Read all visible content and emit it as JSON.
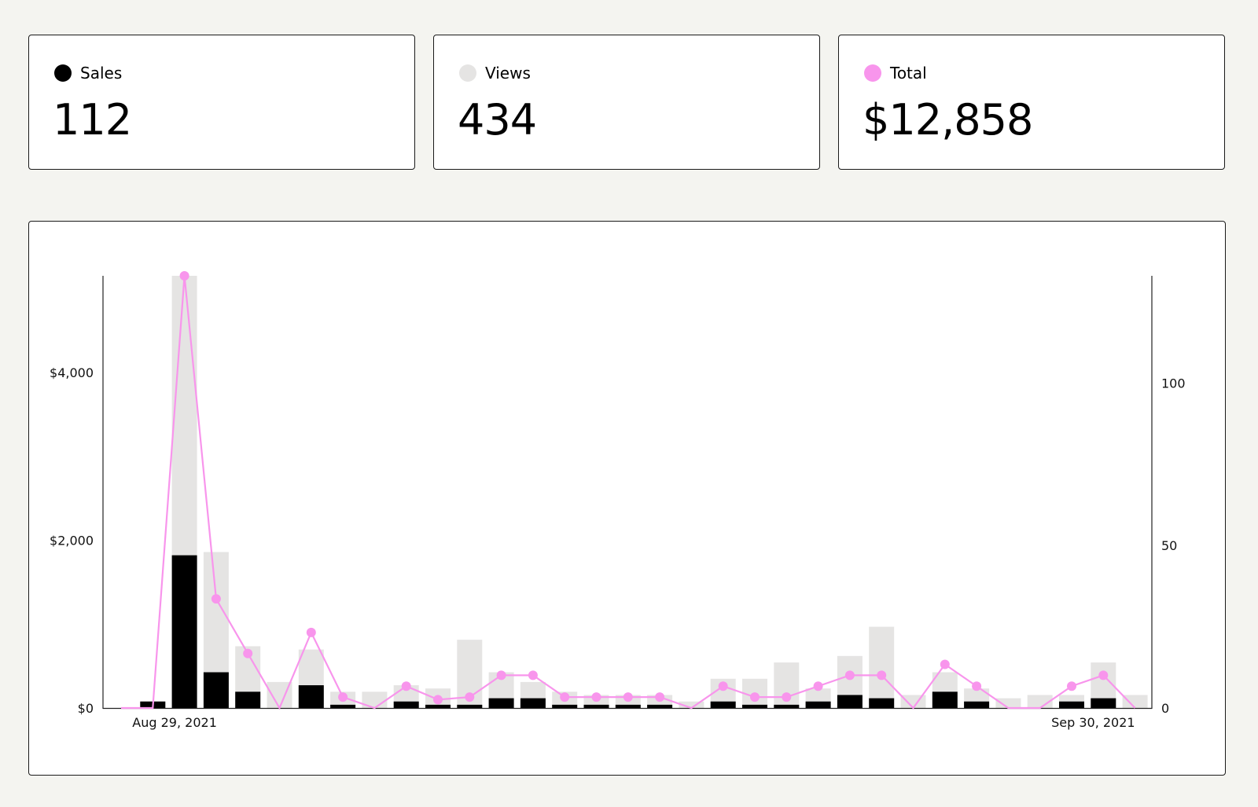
{
  "stats": {
    "sales": {
      "label": "Sales",
      "value": "112",
      "color": "#000000"
    },
    "views": {
      "label": "Views",
      "value": "434",
      "color": "#e5e4e3"
    },
    "total": {
      "label": "Total",
      "value": "$12,858",
      "color": "#f895ec"
    }
  },
  "chart_data": {
    "type": "bar",
    "grid": false,
    "x_start_label": "Aug 29, 2021",
    "x_end_label": "Sep 30, 2021",
    "left_axis": {
      "ticks": [
        0,
        2000,
        4000
      ],
      "tick_labels": [
        "$0",
        "$2,000",
        "$4,000"
      ],
      "range": [
        0,
        5150
      ]
    },
    "right_axis": {
      "ticks": [
        0,
        50,
        100
      ],
      "tick_labels": [
        "0",
        "50",
        "100"
      ],
      "range": [
        0,
        133
      ]
    },
    "series": [
      {
        "name": "Views",
        "type": "bar",
        "axis": "right",
        "color": "#e5e4e3",
        "values": [
          0,
          2,
          133,
          48,
          19,
          8,
          18,
          5,
          5,
          7,
          6,
          21,
          11,
          8,
          5,
          4,
          4,
          4,
          2,
          9,
          9,
          14,
          6,
          16,
          25,
          4,
          11,
          6,
          3,
          4,
          4,
          14,
          4
        ]
      },
      {
        "name": "Sales",
        "type": "bar",
        "axis": "right",
        "color": "#000000",
        "values": [
          0,
          2,
          47,
          11,
          5,
          0,
          7,
          1,
          0,
          2,
          1,
          1,
          3,
          3,
          1,
          1,
          1,
          1,
          0,
          2,
          1,
          1,
          2,
          4,
          3,
          0,
          5,
          2,
          0,
          0,
          2,
          3,
          0
        ]
      },
      {
        "name": "Total",
        "type": "line",
        "axis": "left",
        "color": "#f895ec",
        "values": [
          0,
          0,
          5150,
          1300,
          650,
          0,
          900,
          130,
          0,
          260,
          100,
          130,
          390,
          390,
          130,
          130,
          130,
          130,
          0,
          260,
          130,
          130,
          260,
          390,
          390,
          0,
          520,
          260,
          0,
          0,
          260,
          390,
          0
        ],
        "markers": [
          false,
          false,
          true,
          true,
          true,
          false,
          true,
          true,
          false,
          true,
          true,
          true,
          true,
          true,
          true,
          true,
          true,
          true,
          false,
          true,
          true,
          true,
          true,
          true,
          true,
          false,
          true,
          true,
          false,
          false,
          true,
          true,
          false
        ]
      }
    ]
  }
}
